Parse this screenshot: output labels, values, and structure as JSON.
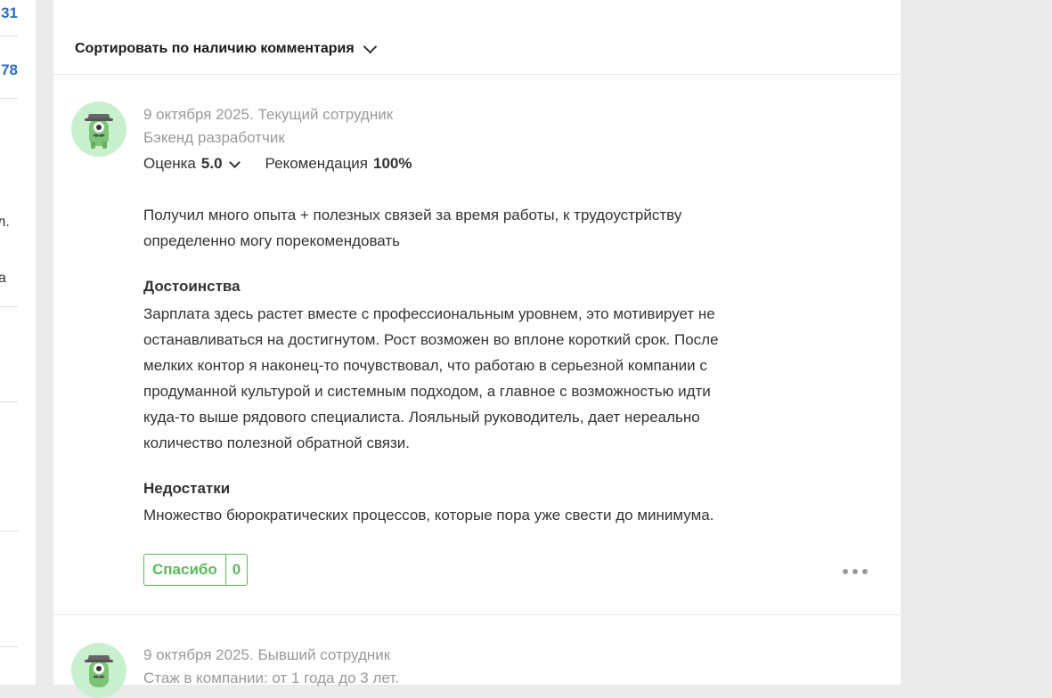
{
  "left_column": {
    "numbers": [
      "31",
      "78"
    ],
    "fragments": [
      "л.",
      "а"
    ]
  },
  "sort": {
    "label": "Сортировать по наличию комментария"
  },
  "reviews": [
    {
      "meta_line1": "9 октября 2025. Текущий сотрудник",
      "meta_line2": "Бэкенд разработчик",
      "rating_label": "Оценка",
      "rating_value": "5.0",
      "recommend_label": "Рекомендация",
      "recommend_value": "100%",
      "summary": "Получил много опыта + полезных связей за время работы, к трудоустрйству определенно могу порекомендовать",
      "pros_title": "Достоинства",
      "pros_text": "Зарплата здесь растет вместе с профессиональным уровнем, это мотивирует не останавливаться на достигнутом. Рост возможен во вплоне короткий срок. После мелких контор я наконец-то почувствовал, что работаю в серьезной компании с продуманной культурой и системным подходом, а главное с возможностью идти куда-то выше рядового специалиста. Лояльный руководитель, дает нереально количество полезной обратной связи.",
      "cons_title": "Недостатки",
      "cons_text": "Множество бюрократических процессов, которые пора уже свести до минимума.",
      "thanks_label": "Спасибо",
      "thanks_count": "0"
    },
    {
      "meta_line1": "9 октября 2025. Бывший сотрудник",
      "meta_line2": "Стаж в компании: от 1 года до 3 лет."
    }
  ],
  "colors": {
    "page_bg": "#ebebeb",
    "card_bg": "#ffffff",
    "link_blue": "#2b6cc4",
    "muted_gray": "#999999",
    "green": "#5cb85c",
    "avatar_bg": "#c8f0cf"
  },
  "icons": {
    "sort_chevron": "chevron-down-icon",
    "rating_chevron": "chevron-down-icon",
    "more": "more-dots-icon",
    "avatar": "green-mascot-avatar-icon"
  }
}
